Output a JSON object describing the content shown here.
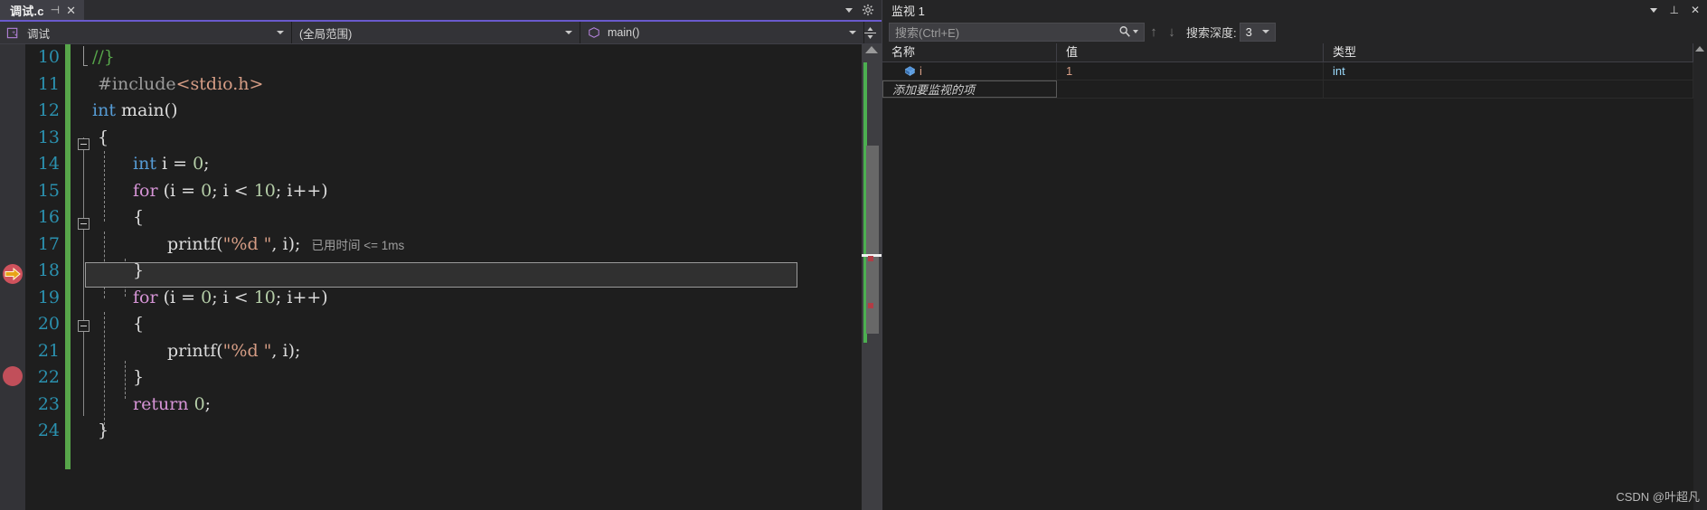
{
  "editor": {
    "tab": {
      "title": "调试.c",
      "pin_icon": "pin-icon",
      "close_icon": "close-icon"
    },
    "tabstrip_right": {
      "caret_icon": "chevron-down-icon",
      "gear_icon": "gear-icon"
    },
    "navbar": {
      "project_combo": {
        "label": "调试",
        "icon": "cpp-project-icon",
        "arrow": "chevron-down-icon"
      },
      "scope_combo": {
        "label": "(全局范围)",
        "arrow": "chevron-down-icon"
      },
      "function_combo": {
        "label": "main()",
        "icon": "cube-icon",
        "arrow": "chevron-down-icon"
      },
      "split_icon": "split-window-icon"
    },
    "gutter": {
      "current_statement_icon": "current-statement-arrow-icon",
      "breakpoint_icon": "breakpoint-dot-icon"
    },
    "elapsed_annotation": "已用时间 <= 1ms",
    "lines": [
      {
        "n": "10",
        "text": "//}"
      },
      {
        "n": "11",
        "text": "#include<stdio.h>"
      },
      {
        "n": "12",
        "text": "int main()"
      },
      {
        "n": "13",
        "text": "{"
      },
      {
        "n": "14",
        "text": "int i = 0;"
      },
      {
        "n": "15",
        "text": "for (i = 0; i < 10; i++)"
      },
      {
        "n": "16",
        "text": "{"
      },
      {
        "n": "17",
        "text": "printf(\"%d \", i);"
      },
      {
        "n": "18",
        "text": "}"
      },
      {
        "n": "19",
        "text": "for (i = 0; i < 10; i++)"
      },
      {
        "n": "20",
        "text": "{"
      },
      {
        "n": "21",
        "text": "printf(\"%d \", i);"
      },
      {
        "n": "22",
        "text": "}"
      },
      {
        "n": "23",
        "text": "return 0;"
      },
      {
        "n": "24",
        "text": "}"
      }
    ],
    "colors": {
      "background": "#1e1e1e",
      "linenumber": "#2b91af",
      "keyword": "#569cd6",
      "control_keyword": "#d694d6",
      "number": "#b5cea8",
      "string": "#d69d85",
      "comment": "#57a64a",
      "changebar": "#57a64a",
      "breakpoint": "#e05561",
      "accent": "#6a5acd"
    }
  },
  "watch": {
    "title": "监视 1",
    "title_buttons": {
      "caret_icon": "chevron-down-icon",
      "pin_icon": "pin-icon",
      "close_icon": "close-icon"
    },
    "search": {
      "placeholder": "搜索(Ctrl+E)",
      "icon": "search-icon",
      "caret_icon": "chevron-down-icon"
    },
    "nav": {
      "prev_icon": "arrow-up-icon",
      "next_icon": "arrow-down-icon"
    },
    "depth": {
      "label": "搜索深度:",
      "value": "3",
      "caret_icon": "chevron-down-icon"
    },
    "columns": [
      "名称",
      "值",
      "类型"
    ],
    "rows": [
      {
        "icon": "cube-icon",
        "name": "i",
        "value": "1",
        "type": "int"
      }
    ],
    "add_row_placeholder": "添加要监视的项"
  },
  "watermark": "CSDN @叶超凡"
}
